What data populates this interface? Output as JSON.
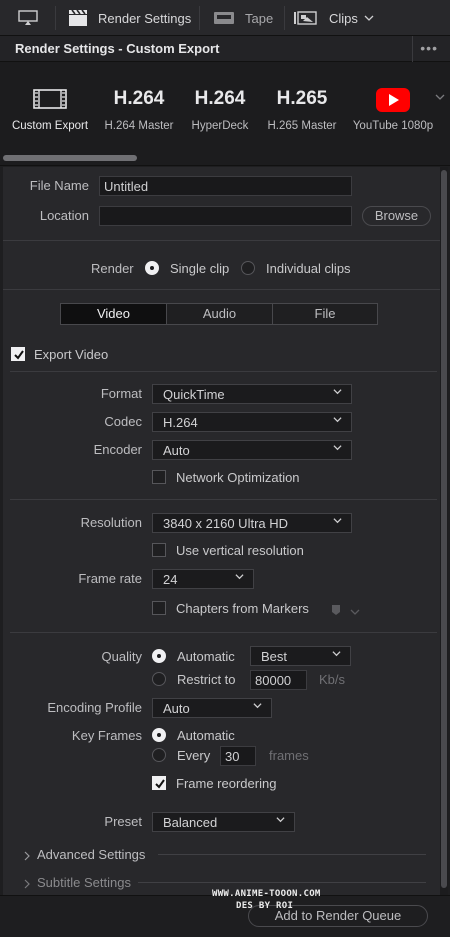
{
  "topbar": {
    "render_settings_label": "Render Settings",
    "tape_label": "Tape",
    "clips_label": "Clips",
    "monitor_icon": "monitor-icon",
    "clapper_icon": "clapperboard-icon",
    "tape_icon": "tape-icon",
    "clips_icon": "clips-icon"
  },
  "header": {
    "title": "Render Settings - Custom Export",
    "more": "•••"
  },
  "presets": [
    {
      "big": "",
      "label": "Custom Export",
      "icon": "film-icon",
      "selected": true
    },
    {
      "big": "H.264",
      "label": "H.264 Master"
    },
    {
      "big": "H.264",
      "label": "HyperDeck"
    },
    {
      "big": "H.265",
      "label": "H.265 Master"
    },
    {
      "big": "",
      "label": "YouTube 1080p",
      "icon": "youtube-icon"
    }
  ],
  "file": {
    "file_name_label": "File Name",
    "file_name_value": "Untitled",
    "location_label": "Location",
    "location_value": "",
    "browse_label": "Browse"
  },
  "render": {
    "label": "Render",
    "single_clip": "Single clip",
    "individual_clips": "Individual clips"
  },
  "tabs": [
    "Video",
    "Audio",
    "File"
  ],
  "export_video": "Export Video",
  "format": {
    "format_label": "Format",
    "format_value": "QuickTime",
    "codec_label": "Codec",
    "codec_value": "H.264",
    "encoder_label": "Encoder",
    "encoder_value": "Auto",
    "network_opt": "Network Optimization"
  },
  "resolution": {
    "label": "Resolution",
    "value": "3840 x 2160 Ultra HD",
    "vertical": "Use vertical resolution",
    "frame_rate_label": "Frame rate",
    "frame_rate_value": "24",
    "chapters": "Chapters from Markers"
  },
  "quality": {
    "label": "Quality",
    "automatic": "Automatic",
    "best": "Best",
    "restrict_to": "Restrict to",
    "restrict_value": "80000",
    "unit": "Kb/s",
    "encoding_profile_label": "Encoding Profile",
    "encoding_profile_value": "Auto",
    "key_frames_label": "Key Frames",
    "kf_automatic": "Automatic",
    "kf_every": "Every",
    "kf_every_value": "30",
    "kf_frames": "frames",
    "frame_reordering": "Frame reordering",
    "preset_label": "Preset",
    "preset_value": "Balanced"
  },
  "sections": {
    "advanced": "Advanced Settings",
    "subtitle": "Subtitle Settings"
  },
  "footer": {
    "add_to_queue": "Add to Render Queue"
  },
  "watermark": {
    "line1": "WWW.ANIME-TOOON.COM",
    "line2": "DES BY ROI"
  },
  "colors": {
    "youtube_red": "#ff0000",
    "panel_bg": "#28282b"
  }
}
